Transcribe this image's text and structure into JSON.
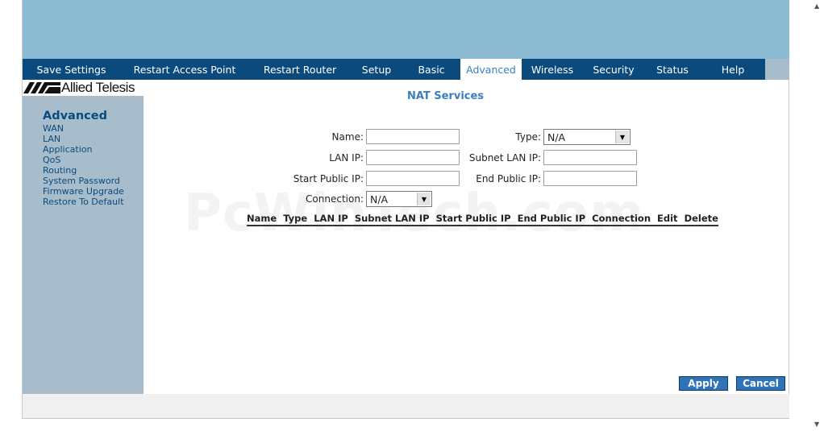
{
  "nav": {
    "items": [
      {
        "label": "Save Settings",
        "width": 121
      },
      {
        "label": "Restart Access Point",
        "width": 160
      },
      {
        "label": "Restart Router",
        "width": 126
      },
      {
        "label": "Setup",
        "width": 64
      },
      {
        "label": "Basic",
        "width": 72
      },
      {
        "label": "Advanced",
        "width": 76,
        "active": true
      },
      {
        "label": "Wireless",
        "width": 76
      },
      {
        "label": "Security",
        "width": 76
      },
      {
        "label": "Status",
        "width": 70
      },
      {
        "label": "Help",
        "width": 80
      }
    ]
  },
  "logo": {
    "text": "Allied Telesis"
  },
  "sidebar": {
    "title": "Advanced",
    "items": [
      "WAN",
      "LAN",
      "Application",
      "QoS",
      "Routing",
      "System Password",
      "Firmware Upgrade",
      "Restore To Default"
    ]
  },
  "main": {
    "title": "NAT Services",
    "form": {
      "name_label": "Name:",
      "name_value": "",
      "type_label": "Type:",
      "type_value": "N/A",
      "lan_ip_label": "LAN IP:",
      "lan_ip_value": "",
      "subnet_lan_ip_label": "Subnet LAN IP:",
      "subnet_lan_ip_value": "",
      "start_public_ip_label": "Start Public IP:",
      "start_public_ip_value": "",
      "end_public_ip_label": "End Public IP:",
      "end_public_ip_value": "",
      "connection_label": "Connection:",
      "connection_value": "N/A"
    },
    "table": {
      "columns": [
        "Name",
        "Type",
        "LAN IP",
        "Subnet LAN IP",
        "Start Public IP",
        "End Public IP",
        "Connection",
        "Edit",
        "Delete"
      ]
    },
    "watermark": "PcWinTech.com",
    "apply_label": "Apply",
    "cancel_label": "Cancel"
  }
}
